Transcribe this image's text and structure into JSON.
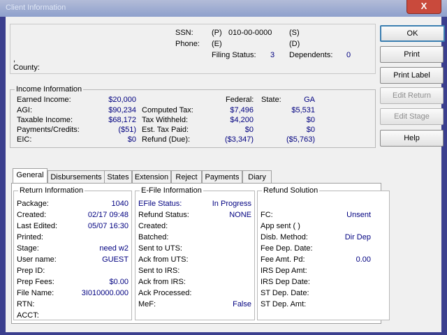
{
  "window": {
    "title": "Client Information",
    "close_glyph": "X"
  },
  "client": {
    "ssn_label": "SSN:",
    "ssn_p_tag": "(P)",
    "ssn_value": "010-00-0000",
    "ssn_s_tag": "(S)",
    "phone_label": "Phone:",
    "phone_e_tag": "(E)",
    "phone_d_tag": "(D)",
    "filing_status_label": "Filing Status:",
    "filing_status_value": "3",
    "dependents_label": "Dependents:",
    "dependents_value": "0",
    "comma": ",",
    "county_label": "County:"
  },
  "income": {
    "title": "Income Information",
    "earned_income_label": "Earned Income:",
    "earned_income_value": "$20,000",
    "agi_label": "AGI:",
    "agi_value": "$90,234",
    "taxable_label": "Taxable Income:",
    "taxable_value": "$68,172",
    "payments_label": "Payments/Credits:",
    "payments_value": "($51)",
    "eic_label": "EIC:",
    "eic_value": "$0",
    "federal_header": "Federal:",
    "state_header": "State:",
    "state_code": "GA",
    "computed_tax_label": "Computed Tax:",
    "computed_tax_federal": "$7,496",
    "computed_tax_state": "$5,531",
    "withheld_label": "Tax Withheld:",
    "withheld_federal": "$4,200",
    "withheld_state": "$0",
    "est_paid_label": "Est. Tax Paid:",
    "est_paid_federal": "$0",
    "est_paid_state": "$0",
    "refund_label": "Refund (Due):",
    "refund_federal": "($3,347)",
    "refund_state": "($5,763)"
  },
  "buttons": {
    "ok": "OK",
    "print": "Print",
    "print_label": "Print Label",
    "edit_return": "Edit Return",
    "edit_stage": "Edit Stage",
    "help": "Help"
  },
  "tabs": [
    "General",
    "Disbursements",
    "States",
    "Extension",
    "Reject",
    "Payments",
    "Diary"
  ],
  "return_info": {
    "title": "Return Information",
    "package_label": "Package:",
    "package_value": "1040",
    "created_label": "Created:",
    "created_value": "02/17 09:48",
    "last_edited_label": "Last Edited:",
    "last_edited_value": "05/07 16:30",
    "printed_label": "Printed:",
    "stage_label": "Stage:",
    "stage_value": "need w2",
    "user_label": "User name:",
    "user_value": "GUEST",
    "prep_id_label": "Prep ID:",
    "prep_fees_label": "Prep Fees:",
    "prep_fees_value": "$0.00",
    "file_name_label": "File Name:",
    "file_name_value": "3I010000.000",
    "rtn_label": "RTN:",
    "acct_label": "ACCT:"
  },
  "efile": {
    "title": "E-File Information",
    "status_label": "EFile Status:",
    "status_value": "In Progress",
    "refund_status_label": "Refund Status:",
    "refund_status_value": "NONE",
    "created_label": "Created:",
    "batched_label": "Batched:",
    "sent_uts_label": "Sent to UTS:",
    "ack_uts_label": "Ack from UTS:",
    "sent_irs_label": "Sent to IRS:",
    "ack_irs_label": "Ack from IRS:",
    "ack_processed_label": "Ack Processed:",
    "mef_label": "MeF:",
    "mef_value": "False"
  },
  "refund_solution": {
    "title": "Refund Solution",
    "fc_label": "FC:",
    "fc_value": "Unsent",
    "app_sent_label": "App sent ( )",
    "disb_label": "Disb. Method:",
    "disb_value": "Dir Dep",
    "fee_dep_date_label": "Fee Dep. Date:",
    "fee_amt_label": "Fee Amt. Pd:",
    "fee_amt_value": "0.00",
    "irs_dep_amt_label": "IRS Dep Amt:",
    "irs_dep_date_label": "IRS Dep Date:",
    "st_dep_date_label": "ST Dep. Date:",
    "st_dep_amt_label": "ST Dep. Amt:"
  },
  "colors": {
    "value_text": "#000080",
    "titlebar": "#8ea0cc",
    "close": "#c94a3c",
    "dialog_bg": "#f0f0f0"
  }
}
